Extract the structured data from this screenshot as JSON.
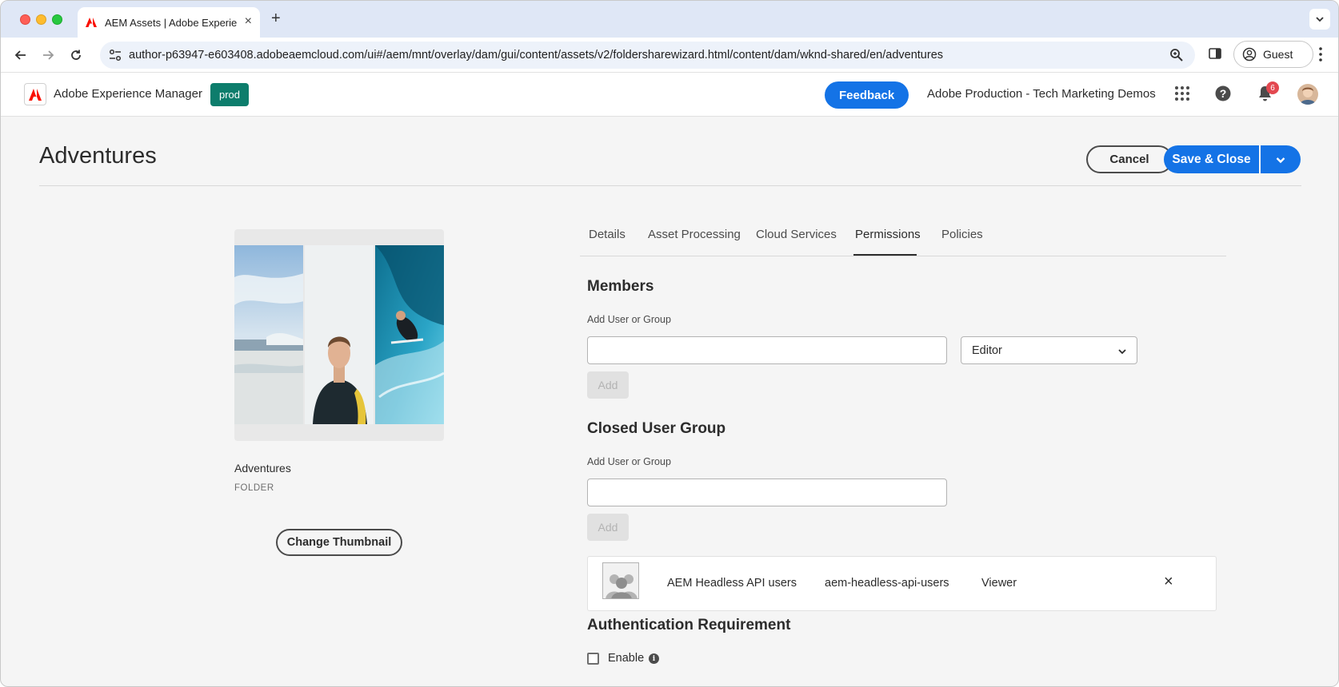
{
  "browser": {
    "tab_title": "AEM Assets | Adobe Experien",
    "url": "author-p63947-e603408.adobeaemcloud.com/ui#/aem/mnt/overlay/dam/gui/content/assets/v2/foldersharewizard.html/content/dam/wknd-shared/en/adventures",
    "profile_label": "Guest"
  },
  "header": {
    "product_name": "Adobe Experience Manager",
    "environment_badge": "prod",
    "feedback_label": "Feedback",
    "org_name": "Adobe Production - Tech Marketing Demos",
    "notification_count": "6"
  },
  "page": {
    "title": "Adventures",
    "cancel_label": "Cancel",
    "save_close_label": "Save & Close"
  },
  "asset": {
    "name": "Adventures",
    "type": "FOLDER",
    "change_thumbnail_label": "Change Thumbnail"
  },
  "tabs": [
    {
      "label": "Details"
    },
    {
      "label": "Asset Processing"
    },
    {
      "label": "Cloud Services"
    },
    {
      "label": "Permissions",
      "active": true
    },
    {
      "label": "Policies"
    }
  ],
  "members": {
    "title": "Members",
    "add_label": "Add User or Group",
    "input_value": "",
    "role_selected": "Editor",
    "add_button": "Add"
  },
  "closed_user_group": {
    "title": "Closed User Group",
    "add_label": "Add User or Group",
    "input_value": "",
    "add_button": "Add",
    "entries": [
      {
        "name": "AEM Headless API users",
        "id": "aem-headless-api-users",
        "role": "Viewer"
      }
    ]
  },
  "authentication": {
    "title": "Authentication Requirement",
    "enable_label": "Enable",
    "enabled": false
  },
  "colors": {
    "accent_blue": "#1473e6",
    "env_badge": "#0d7d6c",
    "notification_red": "#e34850"
  }
}
